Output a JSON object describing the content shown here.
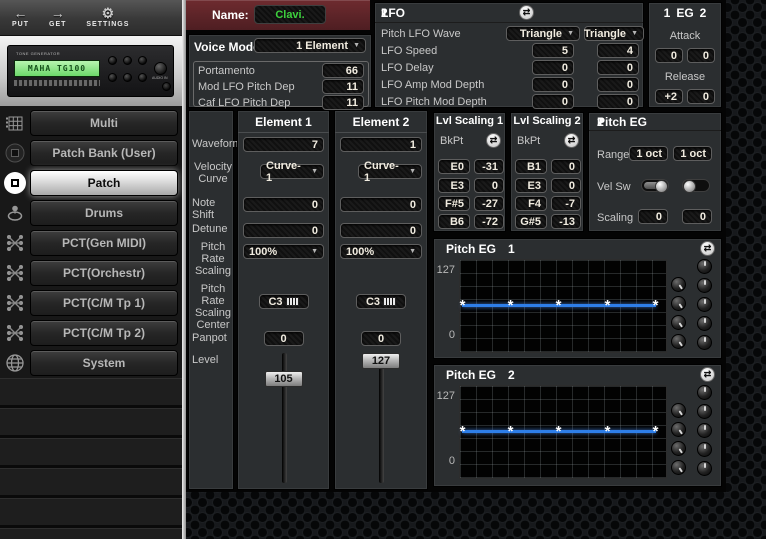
{
  "icons": {
    "arrow_left": "←",
    "arrow_right": "→",
    "gear": "⚙",
    "dropdown": "▼",
    "sync": "⇄",
    "point": "*"
  },
  "toolbar": {
    "put": "PUT",
    "get": "GET",
    "settings": "SETTINGS"
  },
  "device": {
    "brand_label": "TONE GENERATOR",
    "display": "MAHA  TG100",
    "audio_label": "AUDIO IN"
  },
  "sidebar": {
    "items": [
      {
        "label": "Multi"
      },
      {
        "label": "Patch Bank (User)"
      },
      {
        "label": "Patch"
      },
      {
        "label": "Drums"
      },
      {
        "label": "PCT(Gen MIDI)"
      },
      {
        "label": "PCT(Orchestr)"
      },
      {
        "label": "PCT(C/M Tp 1)"
      },
      {
        "label": "PCT(C/M Tp 2)"
      },
      {
        "label": "System"
      }
    ]
  },
  "name_panel": {
    "label": "Name:",
    "value": "Clavi."
  },
  "voice_mode": {
    "label": "Voice Mode:",
    "value": "1 Element"
  },
  "common": {
    "rows": [
      {
        "label": "Portamento",
        "value": "66"
      },
      {
        "label": "Mod LFO Pitch Dep",
        "value": "11"
      },
      {
        "label": "Caf LFO Pitch Dep",
        "value": "11"
      }
    ]
  },
  "lfo": {
    "title": "LFO",
    "col1": "1",
    "col2": "2",
    "wave": {
      "label": "Pitch LFO Wave",
      "v1": "Triangle",
      "v2": "Triangle"
    },
    "rows": [
      {
        "label": "LFO Speed",
        "v1": "5",
        "v2": "4"
      },
      {
        "label": "LFO Delay",
        "v1": "0",
        "v2": "0"
      },
      {
        "label": "LFO Amp Mod Depth",
        "v1": "0",
        "v2": "0"
      },
      {
        "label": "LFO Pitch Mod Depth",
        "v1": "0",
        "v2": "0"
      }
    ]
  },
  "eg": {
    "col1": "1",
    "title": "EG",
    "col2": "2",
    "attack": {
      "label": "Attack",
      "v1": "0",
      "v2": "0"
    },
    "release": {
      "label": "Release",
      "v1": "+2",
      "v2": "0"
    }
  },
  "element_labels": {
    "waveform": "Waveform",
    "velocity_curve": "Velocity Curve",
    "note_shift": "Note Shift",
    "detune": "Detune",
    "pitch_rate_scaling": "Pitch Rate Scaling",
    "scaling_center": "Pitch Rate Scaling Center",
    "panpot": "Panpot",
    "level": "Level"
  },
  "element1": {
    "title": "Element 1",
    "waveform": "7",
    "velocity_curve": "Curve-1",
    "note_shift": "0",
    "detune": "0",
    "pitch_rate_scaling": "100%",
    "scaling_center": "C3",
    "panpot": "0",
    "level": "105"
  },
  "element2": {
    "title": "Element 2",
    "waveform": "1",
    "velocity_curve": "Curve-1",
    "note_shift": "0",
    "detune": "0",
    "pitch_rate_scaling": "100%",
    "scaling_center": "C3",
    "panpot": "0",
    "level": "127"
  },
  "lvl_scaling1": {
    "title": "Lvl Scaling 1",
    "bkpt": "BkPt",
    "rows": [
      {
        "note": "E0",
        "offset": "-31"
      },
      {
        "note": "E3",
        "offset": "0"
      },
      {
        "note": "F#5",
        "offset": "-27"
      },
      {
        "note": "B6",
        "offset": "-72"
      }
    ]
  },
  "lvl_scaling2": {
    "title": "Lvl Scaling 2",
    "bkpt": "BkPt",
    "rows": [
      {
        "note": "B1",
        "offset": "0"
      },
      {
        "note": "E3",
        "offset": "0"
      },
      {
        "note": "F4",
        "offset": "-7"
      },
      {
        "note": "G#5",
        "offset": "-13"
      }
    ]
  },
  "pitch_eg": {
    "title": "Pitch EG",
    "col1": "1",
    "col2": "2",
    "range": {
      "label": "Range",
      "v1": "1 oct",
      "v2": "1 oct"
    },
    "vel_sw": {
      "label": "Vel Sw",
      "v1": "on",
      "v2": "off"
    },
    "scaling": {
      "label": "Scaling",
      "v1": "0",
      "v2": "0"
    }
  },
  "pitch_eg1": {
    "title": "Pitch EG",
    "num": "1",
    "y_max": "127",
    "y_min": "0"
  },
  "pitch_eg2": {
    "title": "Pitch EG",
    "num": "2",
    "y_max": "127",
    "y_min": "0"
  },
  "chart_data": [
    {
      "type": "line",
      "title": "Pitch EG 1",
      "x": [
        0,
        1,
        2,
        3,
        4
      ],
      "values": [
        64,
        64,
        64,
        64,
        64
      ],
      "ylim": [
        0,
        127
      ],
      "ylabel_ticks": [
        "127",
        "0"
      ],
      "grid": true,
      "line_color": "#2e7ee8"
    },
    {
      "type": "line",
      "title": "Pitch EG 2",
      "x": [
        0,
        1,
        2,
        3,
        4
      ],
      "values": [
        64,
        64,
        64,
        64,
        64
      ],
      "ylim": [
        0,
        127
      ],
      "ylabel_ticks": [
        "127",
        "0"
      ],
      "grid": true,
      "line_color": "#2e7ee8"
    }
  ]
}
